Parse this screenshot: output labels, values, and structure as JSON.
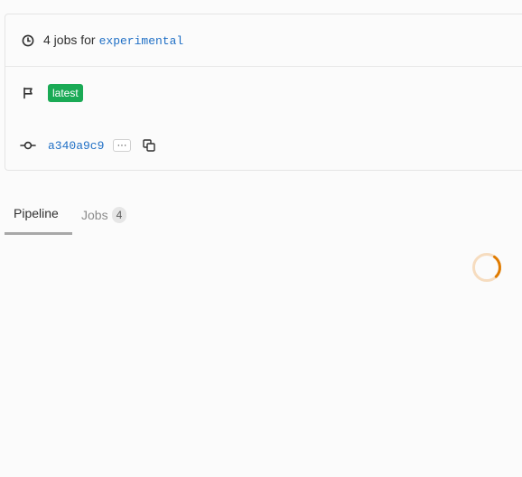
{
  "pipeline_info": {
    "jobs_count_text": "4 jobs for",
    "branch": "experimental",
    "tag_badge": "latest",
    "commit_sha": "a340a9c9",
    "ellipsis_label": "···"
  },
  "tabs": [
    {
      "label": "Pipeline",
      "active": true
    },
    {
      "label": "Jobs",
      "count": "4",
      "active": false
    }
  ],
  "colors": {
    "link": "#1f6fc5",
    "tag_badge_bg": "#1aaa55",
    "spinner": "#e07b00"
  },
  "icons": {
    "jobs_row": "clock-icon",
    "tag_row": "flag-icon",
    "commit_row": "commit-icon",
    "copy": "copy-icon"
  }
}
